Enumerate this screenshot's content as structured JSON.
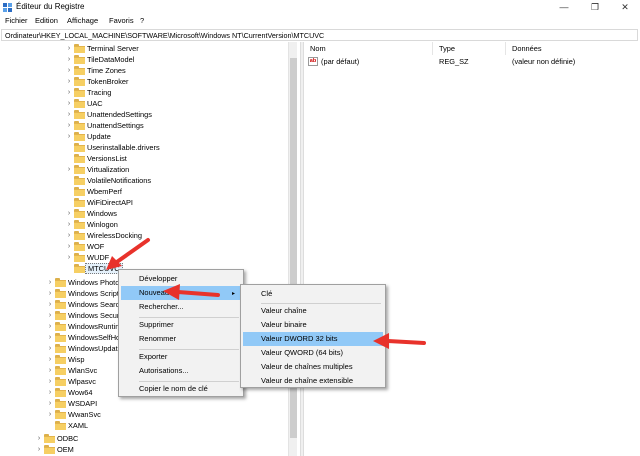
{
  "window": {
    "title": "Éditeur du Registre",
    "minimize": "—",
    "maximize": "❐",
    "close": "✕"
  },
  "menubar": [
    "Fichier",
    "Edition",
    "Affichage",
    "Favoris",
    "?"
  ],
  "address": "Ordinateur\\HKEY_LOCAL_MACHINE\\SOFTWARE\\Microsoft\\Windows NT\\CurrentVersion\\MTCUVC",
  "tree": {
    "inner": [
      "Terminal Server",
      "TileDataModel",
      "Time Zones",
      "TokenBroker",
      "Tracing",
      "UAC",
      "UnattendedSettings",
      "UnattendSettings",
      "Update",
      "Userinstallable.drivers",
      "VersionsList",
      "Virtualization",
      "VolatileNotifications",
      "WbemPerf",
      "WiFiDirectAPI",
      "Windows",
      "Winlogon",
      "WirelessDocking",
      "WOF",
      "WUDF",
      "MTCUVC"
    ],
    "inner_expandable": [
      true,
      true,
      true,
      true,
      true,
      true,
      true,
      true,
      true,
      false,
      false,
      true,
      false,
      false,
      false,
      true,
      true,
      true,
      true,
      true,
      false
    ],
    "outer": [
      "Windows Photo",
      "Windows Script",
      "Windows Search",
      "Windows Security",
      "WindowsRuntime",
      "WindowsSelfHost",
      "WindowsUpdate",
      "Wisp",
      "WlanSvc",
      "Wlpasvc",
      "Wow64",
      "WSDAPI",
      "WwanSvc",
      "XAML"
    ],
    "outer_expandable": [
      true,
      true,
      true,
      true,
      true,
      true,
      true,
      true,
      true,
      true,
      true,
      true,
      true,
      false
    ],
    "root": [
      "ODBC",
      "OEM"
    ]
  },
  "list": {
    "headers": {
      "name": "Nom",
      "type": "Type",
      "data": "Données"
    },
    "rows": [
      {
        "name": "(par défaut)",
        "type": "REG_SZ",
        "data": "(valeur non définie)"
      }
    ]
  },
  "context_menu": {
    "items": [
      "Développer",
      "Nouveau",
      "Rechercher...",
      "Supprimer",
      "Renommer",
      "Exporter",
      "Autorisations...",
      "Copier le nom de clé"
    ],
    "highlighted": "Nouveau"
  },
  "submenu": {
    "items": [
      "Clé",
      "Valeur chaîne",
      "Valeur binaire",
      "Valeur DWORD 32 bits",
      "Valeur QWORD (64 bits)",
      "Valeur de chaînes multiples",
      "Valeur de chaîne extensible"
    ],
    "highlighted": "Valeur DWORD 32 bits"
  },
  "colors": {
    "highlight": "#91c9f7",
    "arrow": "#e8322b",
    "folder": "#f6cf63"
  },
  "icons": {
    "expand": "›",
    "submenu_arrow": "▸"
  }
}
